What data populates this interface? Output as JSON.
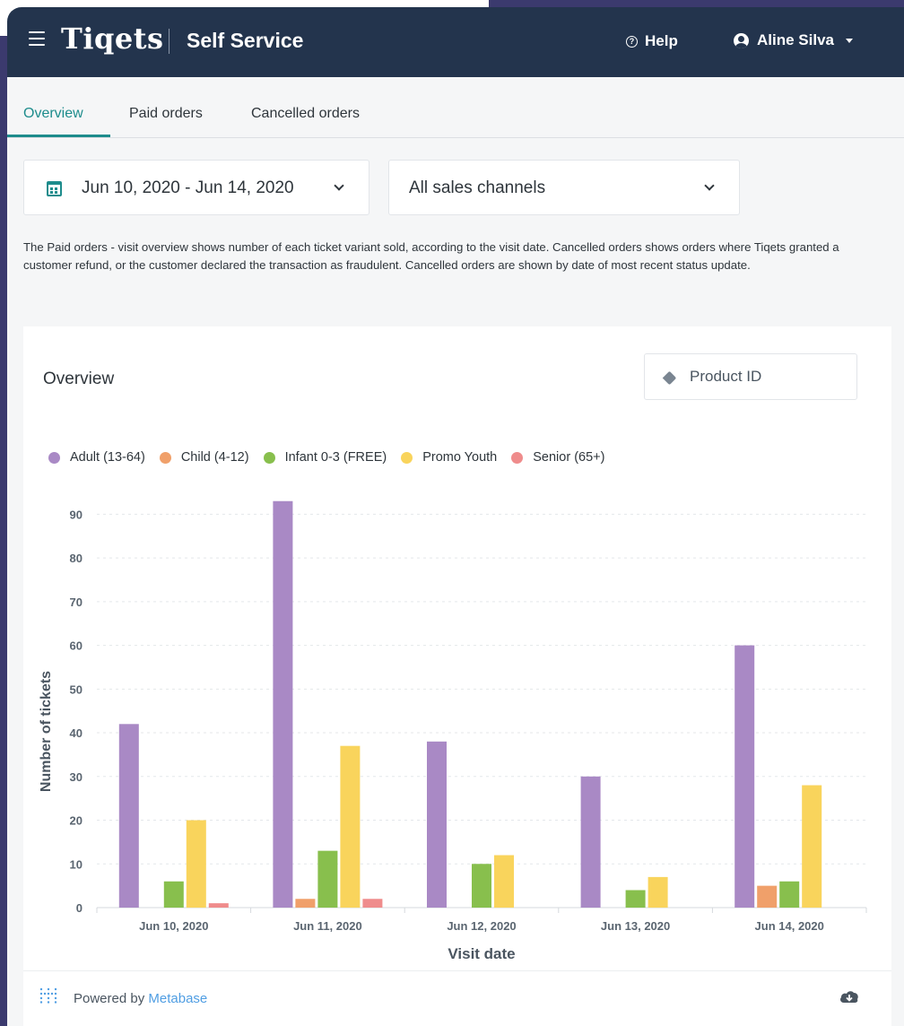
{
  "header": {
    "logo": "Tiqets",
    "app_title": "Self Service",
    "help_label": "Help",
    "user_name": "Aline Silva"
  },
  "tabs": [
    {
      "label": "Overview",
      "active": true
    },
    {
      "label": "Paid orders",
      "active": false
    },
    {
      "label": "Cancelled orders",
      "active": false
    }
  ],
  "filters": {
    "date_range": "Jun 10, 2020 - Jun 14, 2020",
    "sales_channel": "All sales channels"
  },
  "description": "The Paid orders - visit overview shows number of each ticket variant sold, according to the visit date. Cancelled orders shows orders where Tiqets granted a customer refund, or the customer declared the transaction as fraudulent. Cancelled orders are shown by date of most recent status update.",
  "card": {
    "title": "Overview",
    "product_filter_placeholder": "Product ID"
  },
  "footer": {
    "powered_prefix": "Powered by",
    "powered_link": "Metabase"
  },
  "colors": {
    "header_bg": "#23344d",
    "accent": "#1d8c8c",
    "page_bg": "#3b3a6e"
  },
  "chart_data": {
    "type": "bar",
    "xlabel": "Visit date",
    "ylabel": "Number of tickets",
    "ylim": [
      0,
      95
    ],
    "yticks": [
      0,
      10,
      20,
      30,
      40,
      50,
      60,
      70,
      80,
      90
    ],
    "grid": true,
    "legend_position": "top-left",
    "categories": [
      "Jun 10, 2020",
      "Jun 11, 2020",
      "Jun 12, 2020",
      "Jun 13, 2020",
      "Jun 14, 2020"
    ],
    "series": [
      {
        "name": "Adult (13-64)",
        "color": "#a989c5",
        "values": [
          42,
          93,
          38,
          30,
          60
        ]
      },
      {
        "name": "Child (4-12)",
        "color": "#f0a06a",
        "values": [
          0,
          2,
          0,
          0,
          5
        ]
      },
      {
        "name": "Infant 0-3 (FREE)",
        "color": "#88bf4d",
        "values": [
          6,
          13,
          10,
          4,
          6
        ]
      },
      {
        "name": "Promo Youth",
        "color": "#f9d45c",
        "values": [
          20,
          37,
          12,
          7,
          28
        ]
      },
      {
        "name": "Senior (65+)",
        "color": "#ef8c8c",
        "values": [
          1,
          2,
          0,
          0,
          0
        ]
      }
    ]
  }
}
